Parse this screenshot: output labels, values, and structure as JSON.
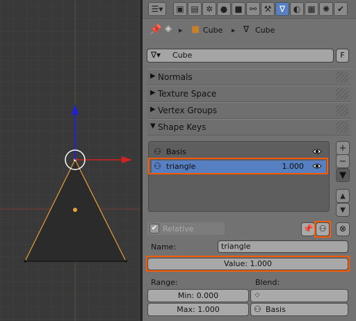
{
  "header": {
    "tabs": [
      {
        "icon": "render-icon"
      },
      {
        "icon": "render-layers-icon"
      },
      {
        "icon": "scene-icon"
      },
      {
        "icon": "world-icon"
      },
      {
        "icon": "object-icon"
      },
      {
        "icon": "constraints-icon"
      },
      {
        "icon": "modifiers-icon"
      },
      {
        "icon": "mesh-data-icon",
        "active": true
      },
      {
        "icon": "material-icon"
      },
      {
        "icon": "texture-icon"
      },
      {
        "icon": "particles-icon"
      },
      {
        "icon": "physics-icon"
      }
    ]
  },
  "breadcrumb": {
    "object": "Cube",
    "mesh": "Cube"
  },
  "datablock": {
    "name": "Cube",
    "fake_user": "F"
  },
  "panels": {
    "normals": "Normals",
    "texture_space": "Texture Space",
    "vertex_groups": "Vertex Groups",
    "shape_keys": "Shape Keys"
  },
  "shape_keys": {
    "items": [
      {
        "name": "Basis",
        "value": ""
      },
      {
        "name": "triangle",
        "value": "1.000"
      }
    ],
    "relative_label": "Relative",
    "name_label": "Name:",
    "name_value": "triangle",
    "value_label": "Value: 1.000",
    "range_label": "Range:",
    "min_label": "Min: 0.000",
    "max_label": "Max: 1.000",
    "blend_label": "Blend:",
    "blend_value": "Basis"
  },
  "colors": {
    "highlight": "#5680c2",
    "annotation": "#ff5a00",
    "axis_x": "#d42020",
    "axis_z": "#2020d4",
    "edge_selected": "#e8a23a"
  }
}
